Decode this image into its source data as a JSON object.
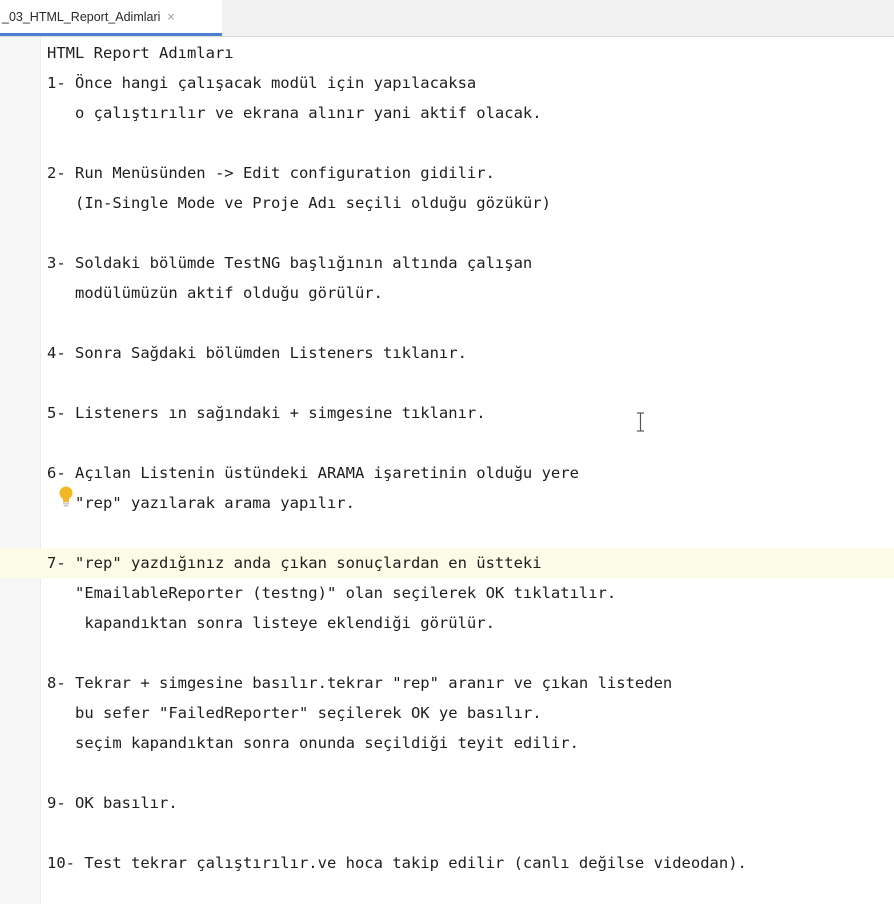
{
  "tab": {
    "label": "_03_HTML_Report_Adimlari",
    "close_glyph": "×"
  },
  "lines": [
    "HTML Report Adımları",
    "1- Önce hangi çalışacak modül için yapılacaksa",
    "   o çalıştırılır ve ekrana alınır yani aktif olacak.",
    "",
    "2- Run Menüsünden -> Edit configuration gidilir.",
    "   (In-Single Mode ve Proje Adı seçili olduğu gözükür)",
    "",
    "3- Soldaki bölümde TestNG başlığının altında çalışan",
    "   modülümüzün aktif olduğu görülür.",
    "",
    "4- Sonra Sağdaki bölümden Listeners tıklanır.",
    "",
    "5- Listeners ın sağındaki + simgesine tıklanır.",
    "",
    "6- Açılan Listenin üstündeki ARAMA işaretinin olduğu yere",
    "   \"rep\" yazılarak arama yapılır.",
    "",
    "7- \"rep\" yazdığınız anda çıkan sonuçlardan en üstteki",
    "   \"EmailableReporter (testng)\" olan seçilerek OK tıklatılır.",
    "    kapandıktan sonra listeye eklendiği görülür.",
    "",
    "8- Tekrar + simgesine basılır.tekrar \"rep\" aranır ve çıkan listeden",
    "   bu sefer \"FailedReporter\" seçilerek OK ye basılır.",
    "   seçim kapandıktan sonra onunda seçildiği teyit edilir.",
    "",
    "9- OK basılır.",
    "",
    "10- Test tekrar çalıştırılır.ve hoca takip edilir (canlı değilse videodan)."
  ],
  "current_line_index": 17,
  "icons": {
    "intention_bulb": "lightbulb-icon",
    "text_cursor": "text-cursor-icon"
  },
  "colors": {
    "tab_underline": "#4a7fd1",
    "current_line_bg": "#fcfbe7",
    "bulb": "#f2b824",
    "text": "#1e1e1e"
  }
}
